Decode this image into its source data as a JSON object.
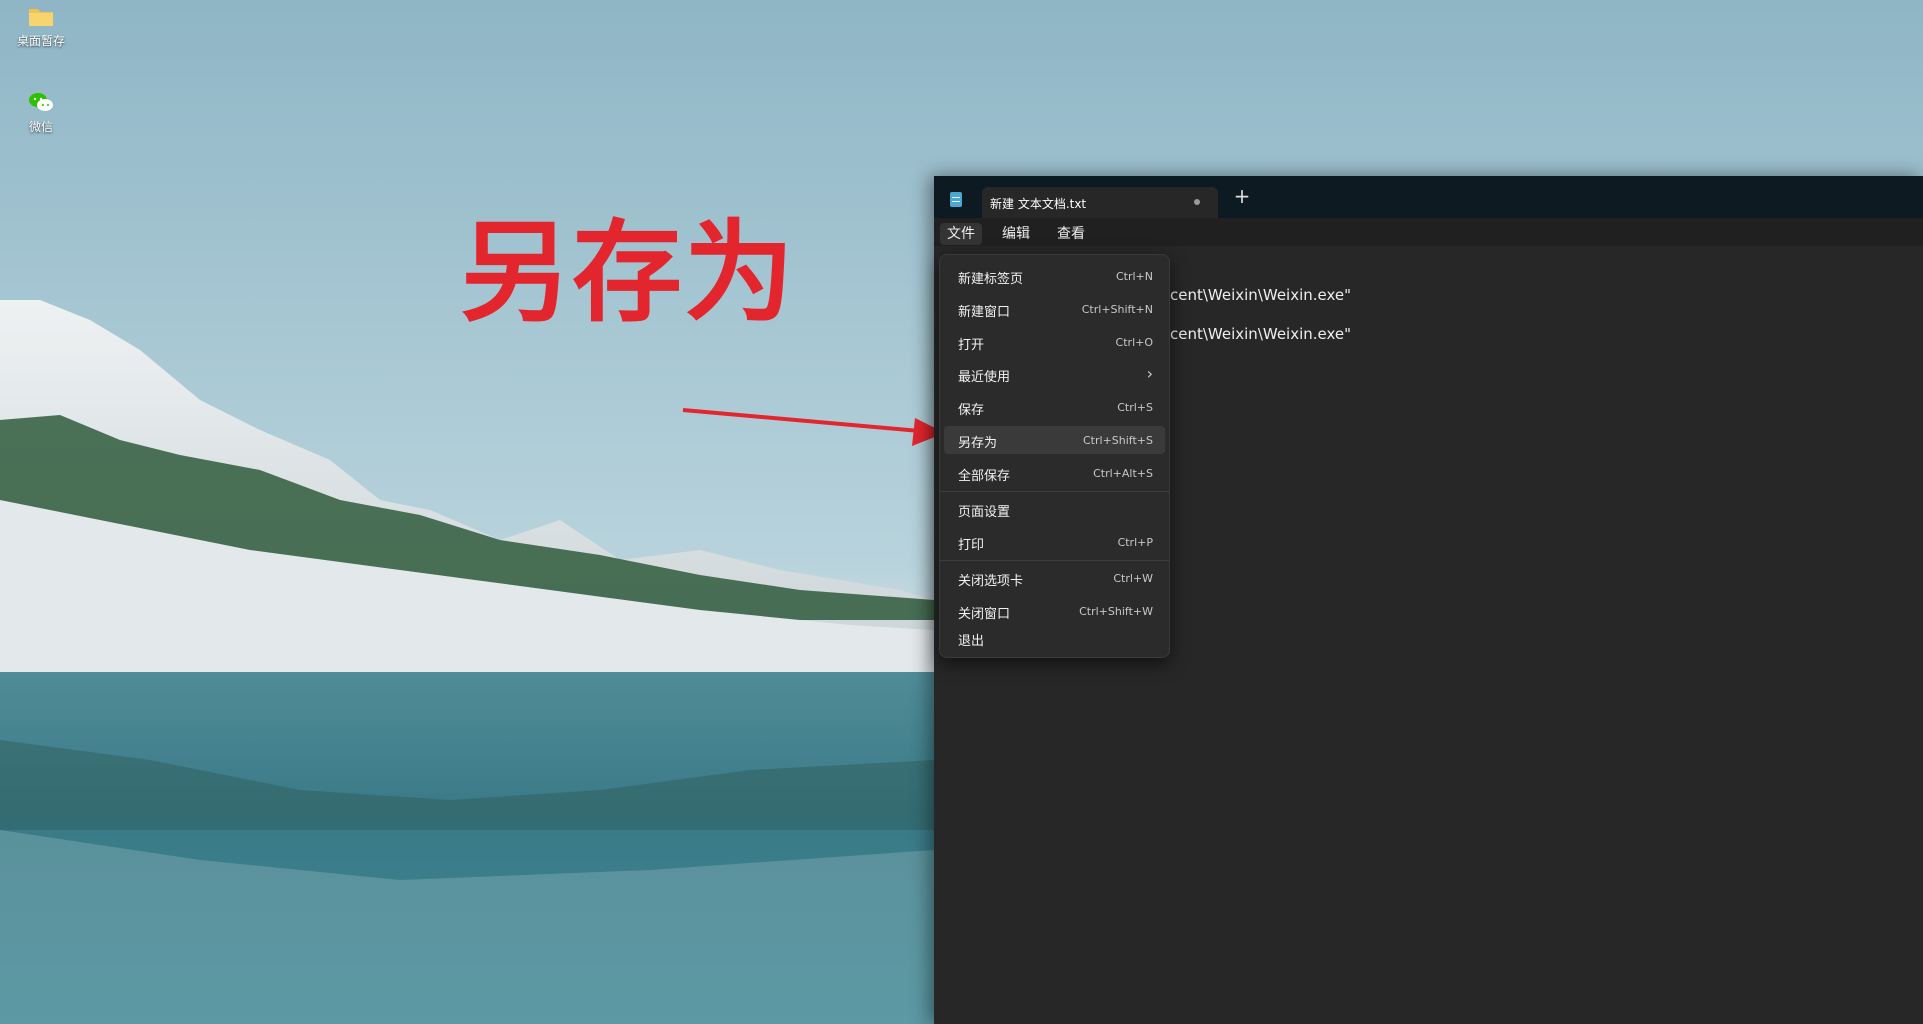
{
  "desktop": {
    "icons": [
      {
        "label": "桌面暂存",
        "icon": "folder-icon"
      },
      {
        "label": "微信",
        "icon": "wechat-icon"
      }
    ]
  },
  "annotation": {
    "caption": "另存为",
    "caption_color": "#e3262e",
    "arrow_color": "#e3262e"
  },
  "notepad": {
    "tab_title": "新建 文本文档.txt",
    "new_tab_symbol": "+",
    "menubar": [
      "文件",
      "编辑",
      "查看"
    ],
    "editor_lines": [
      "cent\\Weixin\\Weixin.exe\"",
      "cent\\Weixin\\Weixin.exe\""
    ]
  },
  "file_menu": {
    "items": [
      {
        "label": "新建标签页",
        "shortcut": "Ctrl+N"
      },
      {
        "label": "新建窗口",
        "shortcut": "Ctrl+Shift+N"
      },
      {
        "label": "打开",
        "shortcut": "Ctrl+O"
      },
      {
        "label": "最近使用",
        "submenu": "›"
      },
      {
        "label": "保存",
        "shortcut": "Ctrl+S"
      },
      {
        "label": "另存为",
        "shortcut": "Ctrl+Shift+S"
      },
      {
        "label": "全部保存",
        "shortcut": "Ctrl+Alt+S"
      },
      {
        "label": "页面设置",
        "shortcut": ""
      },
      {
        "label": "打印",
        "shortcut": "Ctrl+P"
      },
      {
        "label": "关闭选项卡",
        "shortcut": "Ctrl+W"
      },
      {
        "label": "关闭窗口",
        "shortcut": "Ctrl+Shift+W"
      },
      {
        "label": "退出",
        "shortcut": ""
      }
    ]
  },
  "colors": {
    "window_bg": "#272727",
    "menu_bg": "#2b2b2b",
    "titlebar_bg": "#0e1a22"
  }
}
